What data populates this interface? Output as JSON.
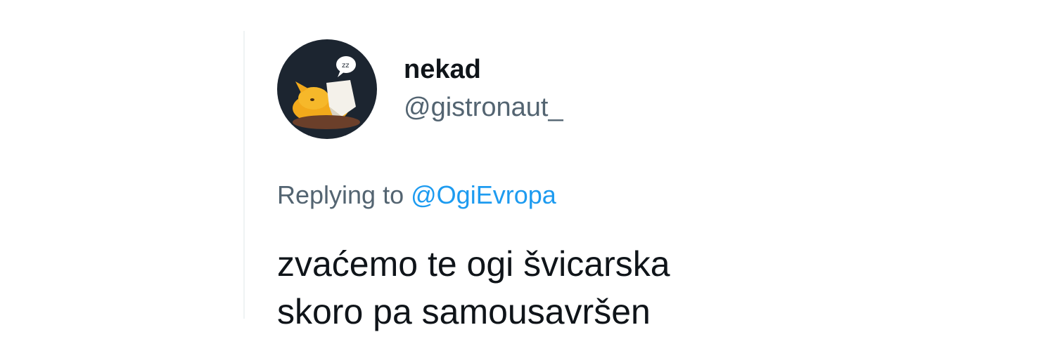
{
  "tweet": {
    "author": {
      "display_name": "nekad",
      "handle": "@gistronaut_",
      "avatar_icon": "cat-avatar-icon"
    },
    "reply": {
      "prefix": "Replying to",
      "mention": "@OgiEvropa"
    },
    "text": "zvaćemo te ogi švicarska\nskoro pa samousavršen"
  },
  "colors": {
    "text_primary": "#0f1419",
    "text_secondary": "#536471",
    "link": "#1d9bf0",
    "avatar_bg": "#1c2530"
  }
}
